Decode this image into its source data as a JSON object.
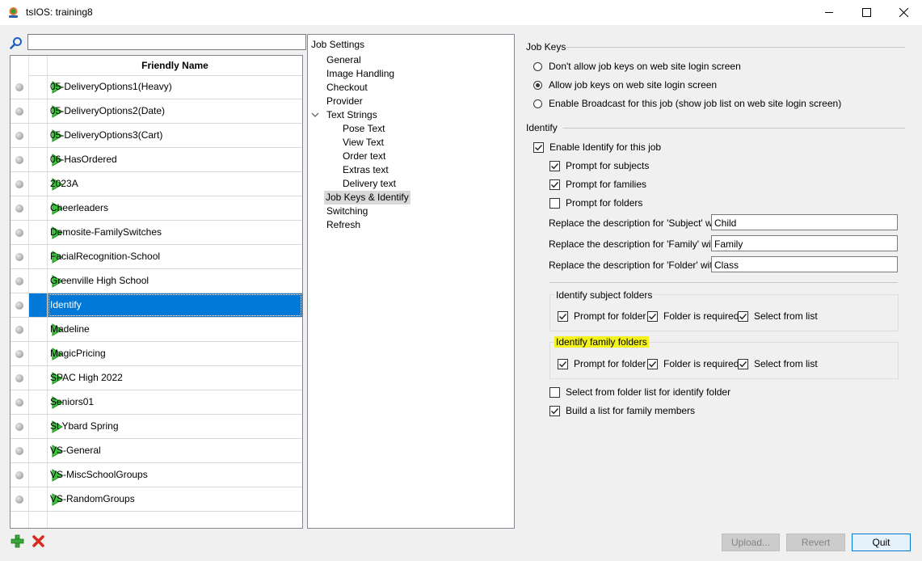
{
  "window": {
    "title": "tsIOS: training8"
  },
  "search": {
    "value": ""
  },
  "jobs": {
    "header": "Friendly Name",
    "items": [
      "05-DeliveryOptions1(Heavy)",
      "05-DeliveryOptions2(Date)",
      "05-DeliveryOptions3(Cart)",
      "06-HasOrdered",
      "2023A",
      "Cheerleaders",
      "Demosite-FamilySwitches",
      "FacialRecognition-School",
      "Greenville High School",
      "Identify",
      "Madeline",
      "MagicPricing",
      "SPAC High 2022",
      "Seniors01",
      "St Ybard Spring",
      "VS-General",
      "VS-MiscSchoolGroups",
      "VS-RandomGroups"
    ],
    "selected": "Identify"
  },
  "tree": {
    "root": "Job Settings",
    "general": "General",
    "image_handling": "Image Handling",
    "checkout": "Checkout",
    "provider": "Provider",
    "text_strings": "Text Strings",
    "pose_text": "Pose Text",
    "view_text": "View Text",
    "order_text": "Order text",
    "extras_text": "Extras text",
    "delivery_text": "Delivery text",
    "job_keys": "Job Keys & Identify",
    "switching": "Switching",
    "refresh": "Refresh"
  },
  "job_keys": {
    "title": "Job Keys",
    "opt1": "Don't allow job keys on web site login screen",
    "opt2": "Allow job keys on web site login screen",
    "opt3": "Enable Broadcast for this job (show job list on web site login screen)",
    "selected": "opt2"
  },
  "identify": {
    "title": "Identify",
    "enable": "Enable Identify for this job",
    "prompt_subjects": "Prompt for subjects",
    "prompt_families": "Prompt for families",
    "prompt_folders": "Prompt for folders",
    "subject_label": "Replace the description for 'Subject' with",
    "subject_value": "Child",
    "family_label": "Replace the description for 'Family' with",
    "family_value": "Family",
    "folder_label": "Replace the description for 'Folder' with",
    "folder_value": "Class",
    "subject_folders": {
      "title": "Identify subject folders",
      "prompt": "Prompt for folder",
      "required": "Folder is required",
      "select": "Select from list"
    },
    "family_folders": {
      "title": "Identify family folders",
      "prompt": "Prompt for folder",
      "required": "Folder is required",
      "select": "Select from list"
    },
    "select_folder_list": "Select from folder list for identify folder",
    "build_list": "Build a list for family members"
  },
  "buttons": {
    "upload": "Upload...",
    "revert": "Revert",
    "quit": "Quit"
  }
}
